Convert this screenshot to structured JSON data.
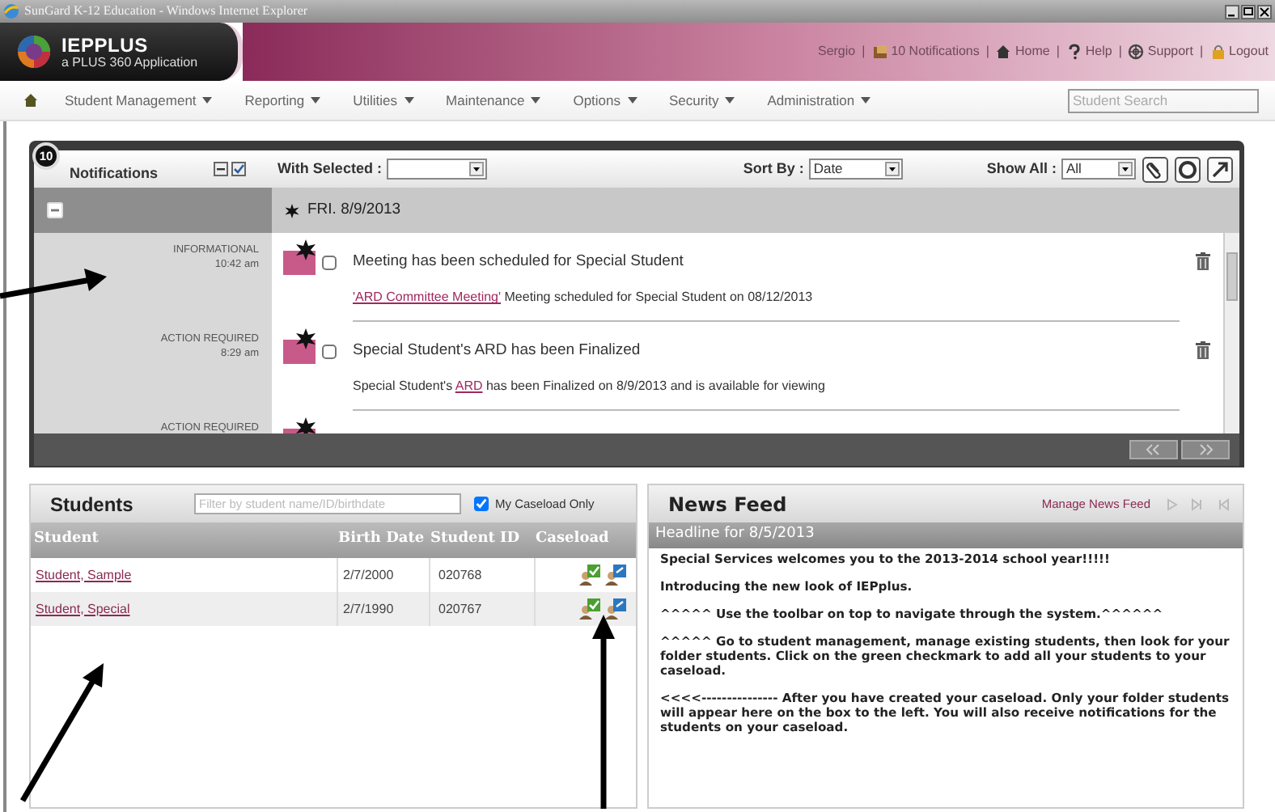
{
  "window": {
    "title": "SunGard K-12 Education - Windows Internet Explorer"
  },
  "app": {
    "name": "IEPPLUS",
    "tagline": "a PLUS 360 Application"
  },
  "header_separator": "|",
  "header_links": [
    {
      "kind": "user",
      "label": "Sergio"
    },
    {
      "kind": "notifications",
      "label": "10 Notifications"
    },
    {
      "kind": "home",
      "label": "Home"
    },
    {
      "kind": "help",
      "label": "Help"
    },
    {
      "kind": "support",
      "label": "Support"
    },
    {
      "kind": "logout",
      "label": "Logout"
    }
  ],
  "menu": [
    "Student Management",
    "Reporting",
    "Utilities",
    "Maintenance",
    "Options",
    "Security",
    "Administration"
  ],
  "student_search": {
    "placeholder": "Student Search"
  },
  "notifications": {
    "count": "10",
    "title": "Notifications",
    "with_selected_label": "With Selected :",
    "sort_by_label": "Sort By :",
    "sort_by_value": "Date",
    "show_all_label": "Show All :",
    "show_all_value": "All",
    "date": "FRI. 8/9/2013",
    "items": [
      {
        "type": "INFORMATIONAL",
        "time": "10:42 am",
        "checked": false,
        "title": "Meeting has been scheduled for Special Student",
        "detail": [
          {
            "text": "'ARD Committee Meeting'",
            "link": true
          },
          {
            "text": " Meeting scheduled for Special Student on 08/12/2013",
            "link": false
          }
        ]
      },
      {
        "type": "ACTION REQUIRED",
        "time": "8:29 am",
        "checked": false,
        "title": "Special Student's ARD has been Finalized",
        "detail": [
          {
            "text": "Special Student's ",
            "link": false
          },
          {
            "text": "ARD",
            "link": true
          },
          {
            "text": " has been Finalized on 8/9/2013 and is available for viewing",
            "link": false
          }
        ]
      },
      {
        "type": "ACTION REQUIRED"
      }
    ]
  },
  "students": {
    "title": "Students",
    "filter_placeholder": "Filter by student name/ID/birthdate",
    "caseload_only": {
      "label": "My Caseload Only",
      "checked": true
    },
    "columns": [
      "Student",
      "Birth Date",
      "Student ID",
      "Caseload"
    ],
    "rows": [
      {
        "student": "Student, Sample",
        "birth_date": "2/7/2000",
        "student_id": "020768"
      },
      {
        "student": "Student, Special",
        "birth_date": "2/7/1990",
        "student_id": "020767"
      }
    ]
  },
  "news_feed": {
    "title": "News Feed",
    "manage_link": "Manage News Feed",
    "headline": "Headline for 8/5/2013",
    "paragraphs": [
      "Special Services welcomes you to the 2013-2014 school year!!!!!",
      "Introducing the new look of IEPplus.",
      "^^^^^ Use the toolbar on top to navigate through the system.^^^^^^",
      "^^^^^ Go to student management, manage existing students, then look for your folder students.  Click on the green checkmark to add all your students to your caseload.",
      "<<<<--------------- After you have created your caseload.  Only your folder students will appear here on the box to the left.   You will also receive notifications for the students on your caseload."
    ]
  }
}
